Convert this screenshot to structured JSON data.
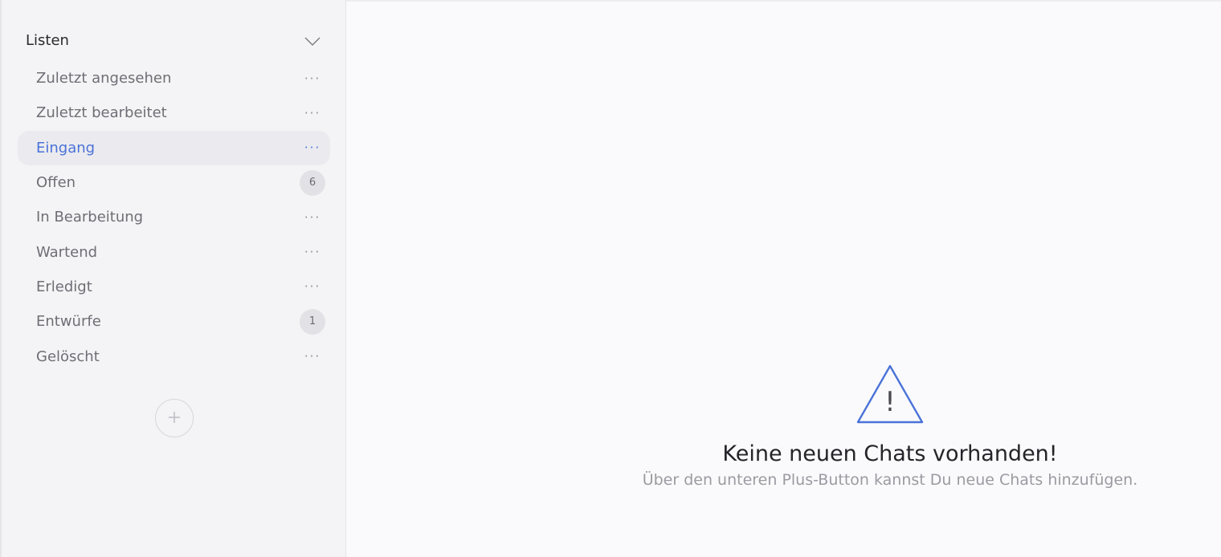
{
  "sidebar": {
    "section_title": "Listen",
    "items": [
      {
        "label": "Zuletzt angesehen",
        "badge": null,
        "active": false
      },
      {
        "label": "Zuletzt bearbeitet",
        "badge": null,
        "active": false
      },
      {
        "label": "Eingang",
        "badge": null,
        "active": true
      },
      {
        "label": "Offen",
        "badge": "6",
        "active": false
      },
      {
        "label": "In Bearbeitung",
        "badge": null,
        "active": false
      },
      {
        "label": "Wartend",
        "badge": null,
        "active": false
      },
      {
        "label": "Erledigt",
        "badge": null,
        "active": false
      },
      {
        "label": "Entwürfe",
        "badge": "1",
        "active": false
      },
      {
        "label": "Gelöscht",
        "badge": null,
        "active": false
      }
    ],
    "more_glyph": "···",
    "add_icon": "plus-icon",
    "chevron_icon": "chevron-down-icon"
  },
  "main": {
    "empty_state": {
      "icon": "warning-icon",
      "title": "Keine neuen Chats vorhanden!",
      "subtitle": "Über den unteren Plus-Button kannst Du neue Chats hinzufügen."
    }
  },
  "colors": {
    "accent": "#4a72d8",
    "sidebar_bg": "#f4f4f6",
    "main_bg": "#fafafc",
    "active_item_bg": "#ebebef",
    "muted_text": "#6e6e76",
    "subtitle_text": "#9a9aa2"
  }
}
